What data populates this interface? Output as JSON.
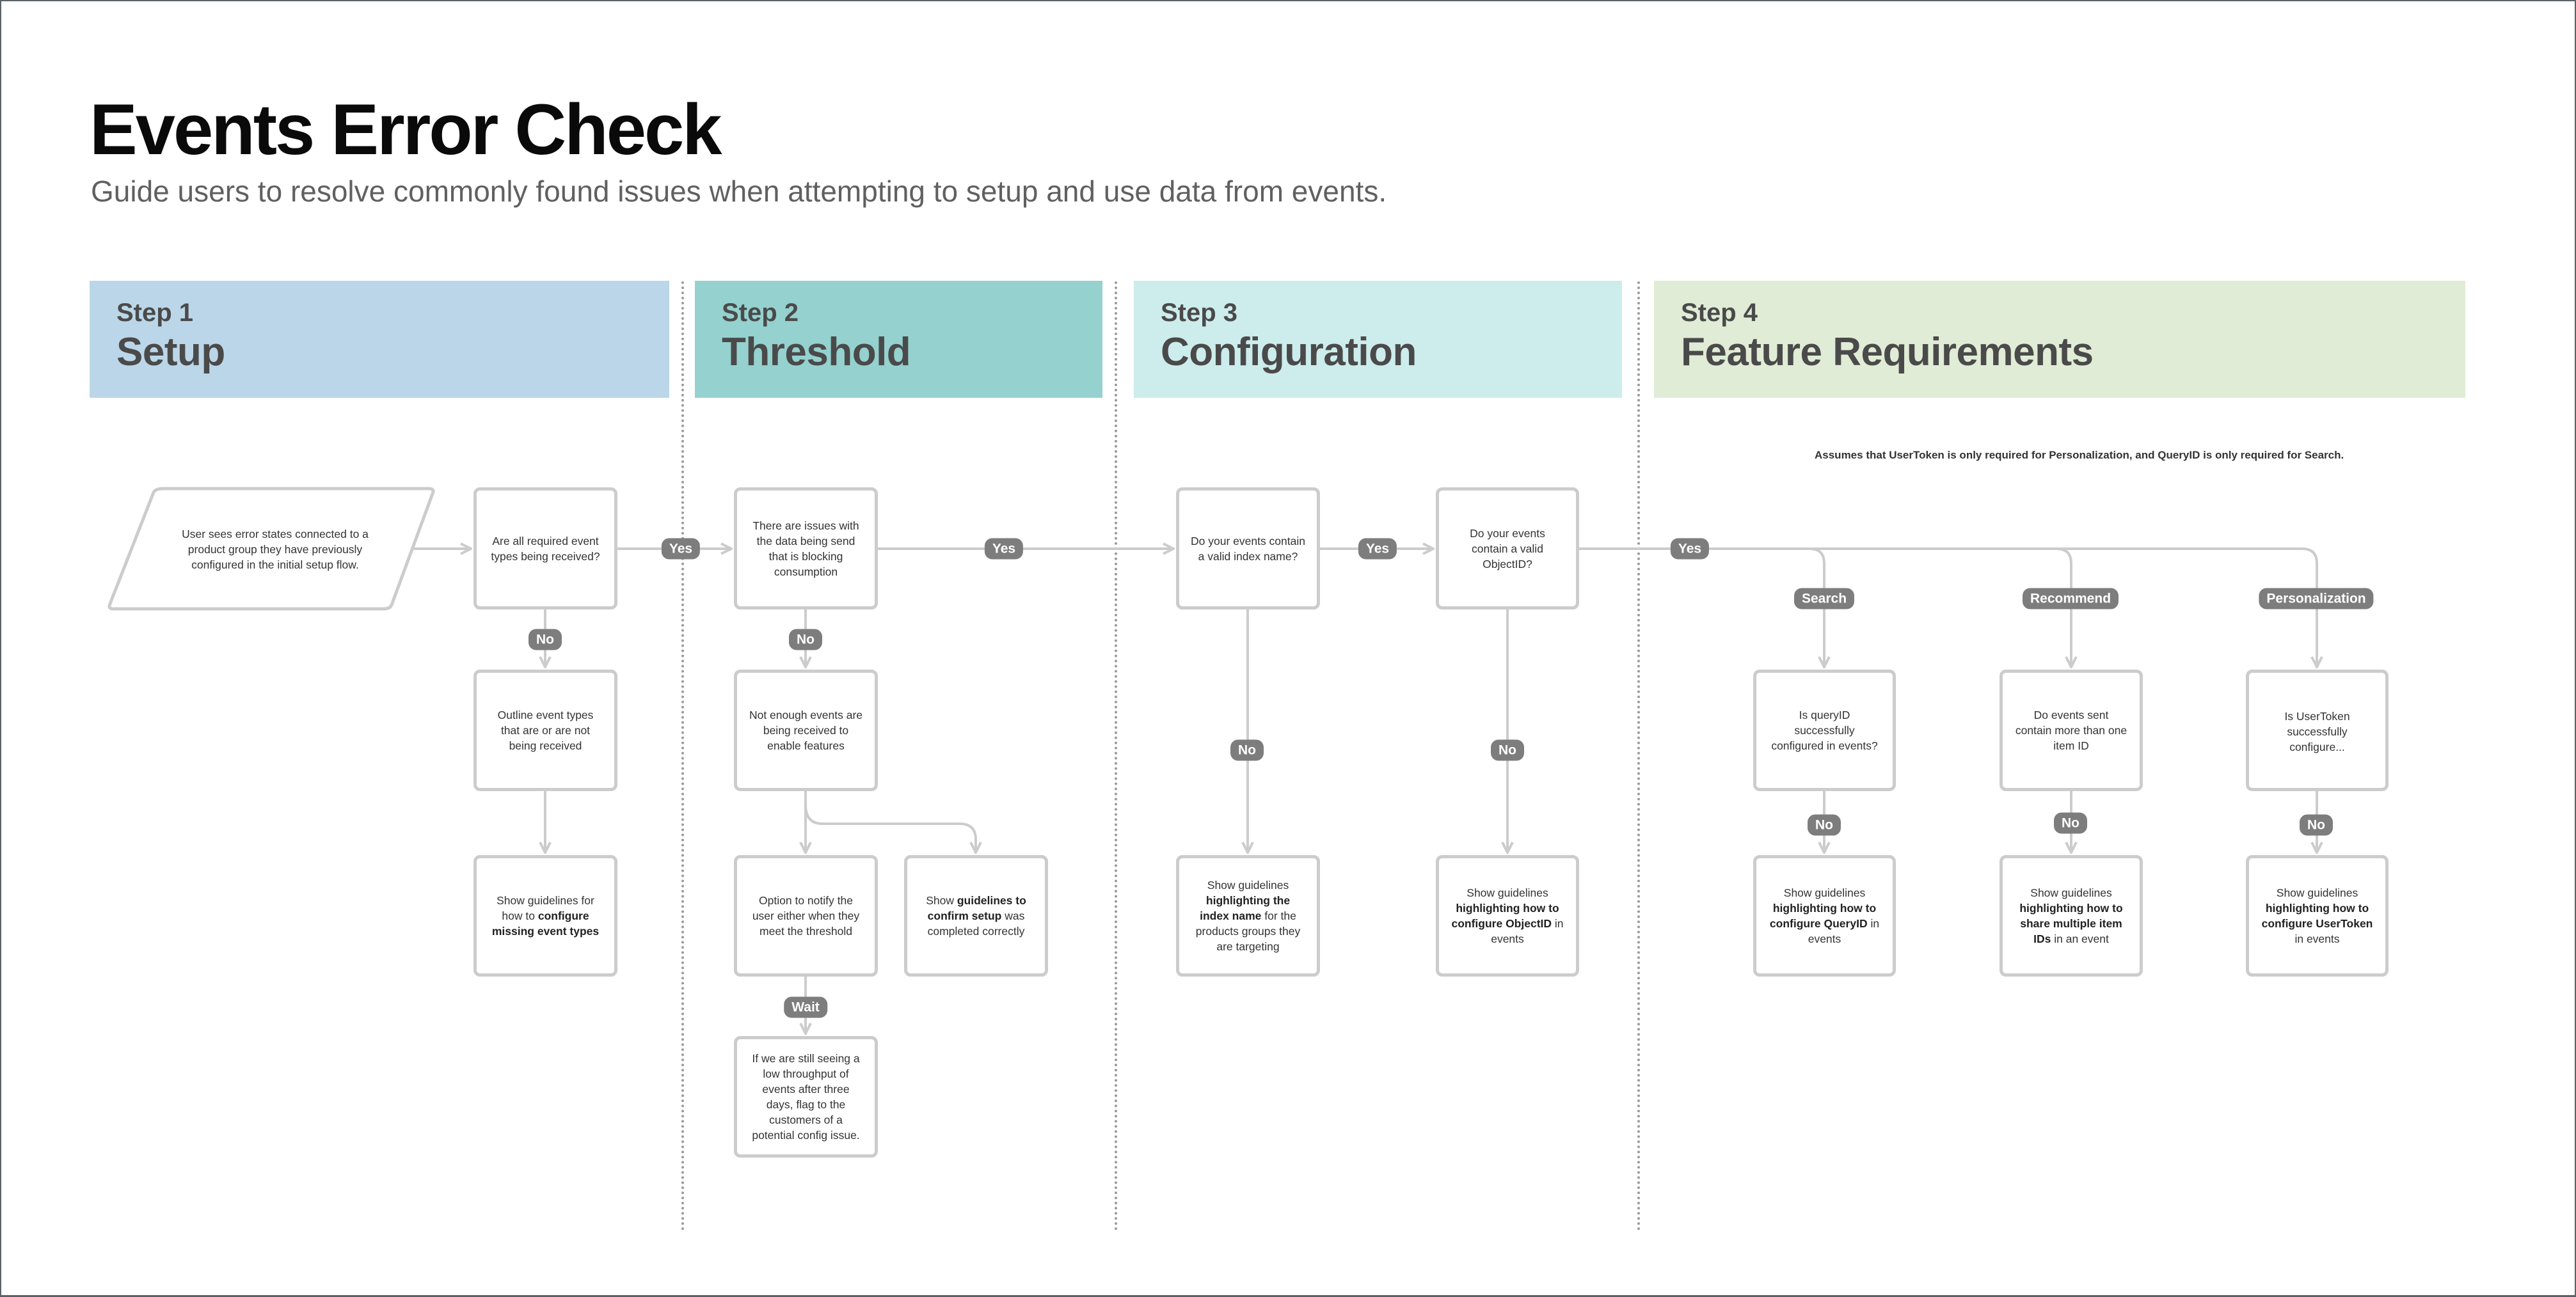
{
  "header": {
    "title": "Events Error Check",
    "subtitle": "Guide users to resolve commonly found issues when attempting to setup and use data from events."
  },
  "steps": [
    {
      "number": "Step 1",
      "name": "Setup",
      "color": "#bbd6e8"
    },
    {
      "number": "Step 2",
      "name": "Threshold",
      "color": "#94d1cf"
    },
    {
      "number": "Step 3",
      "name": "Configuration",
      "color": "#cdecec"
    },
    {
      "number": "Step 4",
      "name": "Feature Requirements",
      "color": "#e0ecd5"
    }
  ],
  "note": "Assumes that UserToken is only required for Personalization, and QueryID is only required for Search.",
  "colors": {
    "connector": "#cccccc",
    "pill": "#7d7d7d",
    "box_border": "#cccccc"
  },
  "nodes": {
    "start": "User sees error states connected to a product group they have previously configured in the initial setup flow.",
    "q_required_events": "Are all required event types being received?",
    "outline_event_types": "Outline event types that are or are not being received",
    "guide_missing_types": {
      "pre": "Show guidelines for how to ",
      "bold": "configure missing event types",
      "post": ""
    },
    "q_data_issues": "There are issues with the data being send that is blocking consumption",
    "not_enough_events": "Not enough events are being received to enable features",
    "notify_option": "Option to notify the user either when they meet the threshold",
    "confirm_setup": {
      "pre": "Show ",
      "bold": "guidelines to confirm setup",
      "post": " was completed correctly"
    },
    "low_throughput_flag": "If we are still seeing a low throughput of events after three days, flag to the customers of a potential config issue.",
    "q_index_name": "Do your events contain a valid index name?",
    "guide_index_name": {
      "pre": "Show guidelines ",
      "bold": "highlighting the index name",
      "post": " for the products groups they are targeting"
    },
    "q_object_id": "Do your events contain a valid ObjectID?",
    "guide_object_id": {
      "pre": "Show guidelines ",
      "bold": "highlighting how to configure ObjectID",
      "post": " in events"
    },
    "q_query_id": "Is queryID successfully configured in events?",
    "guide_query_id": {
      "pre": "Show guidelines ",
      "bold": "highlighting how to configure QueryID",
      "post": " in events"
    },
    "q_multiple_ids": "Do events sent contain more than one item ID",
    "guide_multiple_ids": {
      "pre": "Show guidelines ",
      "bold": "highlighting how to share multiple item IDs",
      "post": " in an event"
    },
    "q_user_token": "Is UserToken successfully configure...",
    "guide_user_token": {
      "pre": "Show guidelines ",
      "bold": "highlighting how to configure UserToken",
      "post": " in events"
    }
  },
  "labels": {
    "yes": "Yes",
    "no": "No",
    "wait": "Wait",
    "search": "Search",
    "recommend": "Recommend",
    "personalization": "Personalization"
  }
}
